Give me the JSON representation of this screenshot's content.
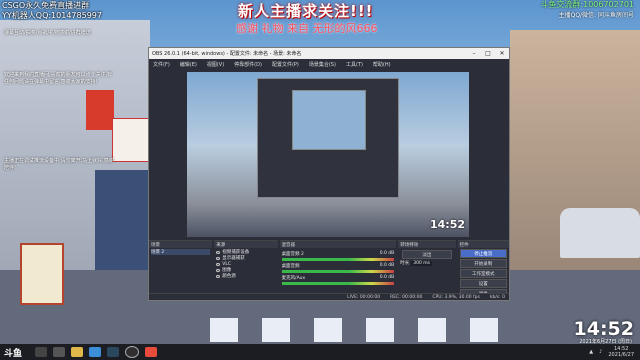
{
  "overlay": {
    "top_left_line1": "CSGO永久免费直播进群",
    "top_left_line2": "YY机器人QQ:1014785997",
    "left_text_top": "弹幕互动/抽奖/点歌/礼物感谢/进群赠送",
    "left_text_block": "欢迎来到我的直播间,喜欢的朋友可以点个关注,有任何问题请在弹幕中留言,感谢大家的支持!",
    "left_text_bottom": "主播正在调试推流设备中,请勿离开,马上就好,感谢陪伴!",
    "banner_title": "新人主播求关注!!!",
    "banner_subtitle": "感谢 礼物 来自 无形的风666",
    "top_right_line1": "斗鱼交流群:1006702701",
    "top_right_line2": "主播QQ/微信: 同斗鱼房间号"
  },
  "obs": {
    "title": "OBS 26.0.1 (64-bit, windows) - 配置文件: 未命名 - 场景: 未命名",
    "menu": [
      "文件(F)",
      "编辑(E)",
      "视图(V)",
      "停靠部件(D)",
      "配置文件(P)",
      "场景集合(S)",
      "工具(T)",
      "帮助(H)"
    ],
    "preview_clock": "14:52",
    "docks": {
      "scenes": {
        "title": "场景",
        "items": [
          "场景 2"
        ]
      },
      "sources": {
        "title": "来源",
        "items": [
          "视频捕获设备",
          "显示器捕获",
          "VLC",
          "图像",
          "颜色源"
        ]
      },
      "mixer": {
        "title": "混音器",
        "channels": [
          {
            "name": "桌面音频 2",
            "level": "0.0 dB"
          },
          {
            "name": "桌面音频",
            "level": "0.0 dB"
          },
          {
            "name": "麦克风/Aux",
            "level": "0.0 dB"
          }
        ]
      },
      "transitions": {
        "title": "转场特效",
        "fade": "淡出",
        "duration_label": "时长",
        "duration": "300 ms"
      },
      "controls": {
        "title": "控件",
        "buttons": [
          "停止推流",
          "开始录制",
          "工作室模式",
          "设置",
          "退出"
        ]
      }
    },
    "status": {
      "live": "LIVE: 00:00:00",
      "rec": "REC: 00:00:00",
      "cpu": "CPU: 3.9%, 30.00 fps",
      "kbps": "kb/s: 0"
    }
  },
  "desktop": {
    "clock": "14:52",
    "date": "2021年6月27日 (周日)"
  },
  "taskbar": {
    "logo": "斗鱼",
    "time": "14:52",
    "date": "2021/6/27"
  },
  "colors": {
    "accent": "#4a6ec8",
    "banner_red": "#ff4e5e",
    "group_green": "#7df17d"
  }
}
